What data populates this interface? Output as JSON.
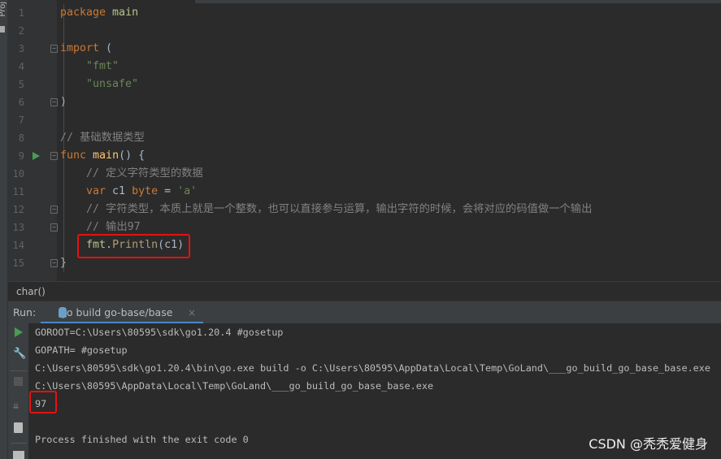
{
  "sidebar": {
    "project_label": "Proj"
  },
  "editor": {
    "lines": [
      {
        "n": "1",
        "tokens": [
          [
            "package",
            "kw"
          ],
          [
            " main",
            "pkg"
          ]
        ]
      },
      {
        "n": "2",
        "tokens": []
      },
      {
        "n": "3",
        "fold": true,
        "tokens": [
          [
            "import",
            "kw"
          ],
          [
            " (",
            "pl"
          ]
        ]
      },
      {
        "n": "4",
        "tokens": [
          [
            "    \"fmt\"",
            "str"
          ]
        ]
      },
      {
        "n": "5",
        "tokens": [
          [
            "    \"unsafe\"",
            "str"
          ]
        ]
      },
      {
        "n": "6",
        "fold": true,
        "tokens": [
          [
            ")",
            "pl"
          ]
        ]
      },
      {
        "n": "7",
        "tokens": []
      },
      {
        "n": "8",
        "tokens": [
          [
            "// 基础数据类型",
            "cm"
          ]
        ]
      },
      {
        "n": "9",
        "run": true,
        "fold": true,
        "tokens": [
          [
            "func",
            "kw"
          ],
          [
            " ",
            "pl"
          ],
          [
            "main",
            "fn"
          ],
          [
            "() {",
            "pl"
          ]
        ]
      },
      {
        "n": "10",
        "tokens": [
          [
            "    // 定义字符类型的数据",
            "cm"
          ]
        ]
      },
      {
        "n": "11",
        "tokens": [
          [
            "    var",
            "kw"
          ],
          [
            " c1 ",
            "pl"
          ],
          [
            "byte",
            "kw"
          ],
          [
            " = ",
            "pl"
          ],
          [
            "'a'",
            "str"
          ]
        ]
      },
      {
        "n": "12",
        "fold": true,
        "tokens": [
          [
            "    // 字符类型，本质上就是一个整数，也可以直接参与运算，输出字符的时候，会将对应的码值做一个输出",
            "cm"
          ]
        ]
      },
      {
        "n": "13",
        "fold": true,
        "tokens": [
          [
            "    // 输出97",
            "cm"
          ]
        ]
      },
      {
        "n": "14",
        "tokens": [
          [
            "    fmt",
            "pkg"
          ],
          [
            ".",
            "pl"
          ],
          [
            "Println",
            "call"
          ],
          [
            "(c1)",
            "pl"
          ]
        ]
      },
      {
        "n": "15",
        "fold": true,
        "tokens": [
          [
            "}",
            "pl"
          ]
        ]
      }
    ]
  },
  "breadcrumb": "char()",
  "run_panel": {
    "label": "Run:",
    "tab": "go build go-base/base",
    "close": "×"
  },
  "console": {
    "lines": [
      "GOROOT=C:\\Users\\80595\\sdk\\go1.20.4 #gosetup",
      "GOPATH= #gosetup",
      "C:\\Users\\80595\\sdk\\go1.20.4\\bin\\go.exe build -o C:\\Users\\80595\\AppData\\Local\\Temp\\GoLand\\___go_build_go_base_base.exe",
      "C:\\Users\\80595\\AppData\\Local\\Temp\\GoLand\\___go_build_go_base_base.exe",
      "97",
      "",
      "Process finished with the exit code 0"
    ]
  },
  "watermark": "CSDN @秃秃爱健身",
  "colors": {
    "highlight": "#e8100f",
    "keyword": "#cc7832",
    "string": "#6a8759",
    "comment": "#808080"
  }
}
